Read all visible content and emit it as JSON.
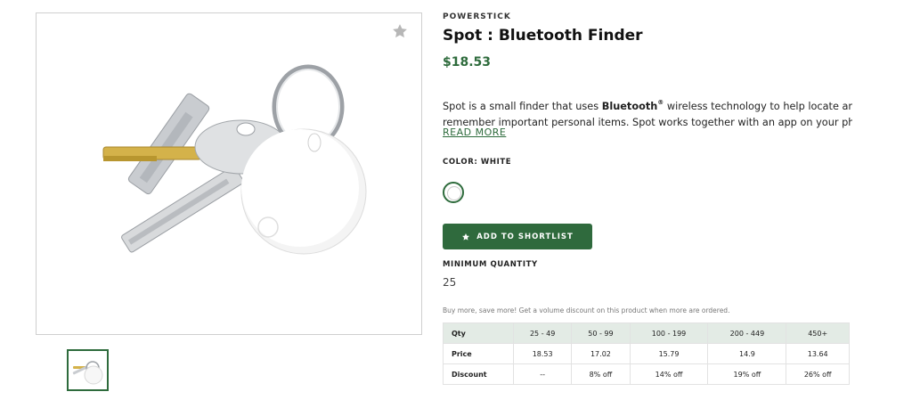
{
  "product": {
    "brand": "POWERSTICK",
    "title": "Spot : Bluetooth Finder",
    "price": "$18.53",
    "description": {
      "line1_pre": "Spot is a small finder that uses ",
      "line1_brand": "Bluetooth",
      "line1_mark": "®",
      "line1_post": " wireless technology to help locate and",
      "line2": "remember important personal items. Spot works together with an app on your phon..."
    },
    "read_more": "READ MORE",
    "color_label": "COLOR: WHITE",
    "selected_color": "#ffffff",
    "add_to_shortlist": "ADD TO SHORTLIST",
    "min_quantity_label": "MINIMUM QUANTITY",
    "min_quantity_value": "25"
  },
  "pricing": {
    "note": "Buy more, save more! Get a volume discount on this product when more are ordered.",
    "qty_label": "Qty",
    "price_label": "Price",
    "discount_label": "Discount",
    "tiers": [
      {
        "qty": "25 - 49",
        "price": "18.53",
        "discount": "--"
      },
      {
        "qty": "50 - 99",
        "price": "17.02",
        "discount": "8% off"
      },
      {
        "qty": "100 - 199",
        "price": "15.79",
        "discount": "14% off"
      },
      {
        "qty": "200 - 449",
        "price": "14.9",
        "discount": "19% off"
      },
      {
        "qty": "450+",
        "price": "13.64",
        "discount": "26% off"
      }
    ]
  },
  "icons": {
    "favorite": "star-icon",
    "shortlist": "star-icon"
  },
  "colors": {
    "accent": "#2e6b3c",
    "table_header_bg": "#e3ebe5"
  }
}
